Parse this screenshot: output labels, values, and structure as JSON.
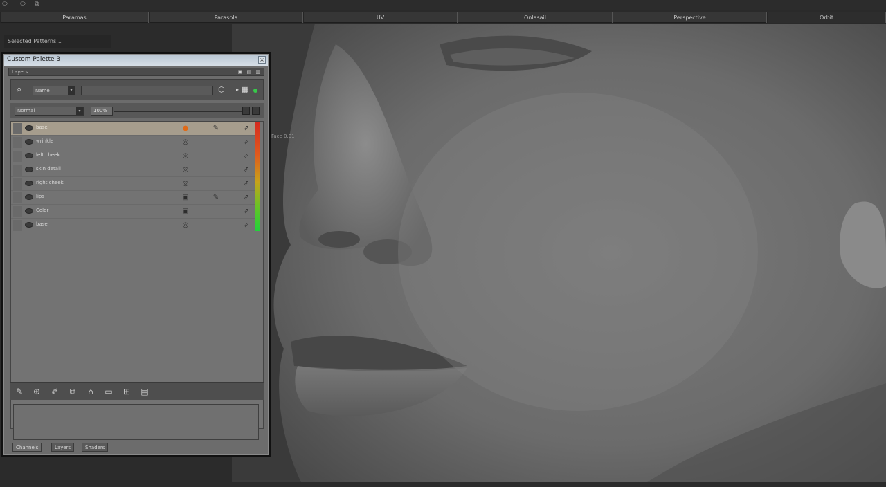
{
  "topbar": {
    "icons": [
      "tool-icon-1",
      "tool-icon-2",
      "tool-icon-3"
    ]
  },
  "tabs": [
    {
      "label": "Paramas"
    },
    {
      "label": "Parasola"
    },
    {
      "label": "UV"
    },
    {
      "label": "Onlasail"
    },
    {
      "label": "Perspective"
    },
    {
      "label": "Orbit"
    }
  ],
  "viewport": {
    "selection_label": "Selected Patterns  1",
    "side_label": "Face 0.01"
  },
  "panel": {
    "title": "Custom Palette 3",
    "subhead_label": "Layers",
    "subhead_buttons": "▣ ▤ ▥",
    "filter_value": "Name",
    "search_value": "",
    "blend_mode": "Normal",
    "opacity": "100%",
    "layers": [
      {
        "name": "base",
        "selected": true,
        "c1": "●",
        "c1_orange": true,
        "c2": "✎",
        "c3": "⇗"
      },
      {
        "name": "wrinkle",
        "selected": false,
        "c1": "◎",
        "c1_orange": false,
        "c2": "",
        "c3": "⇗"
      },
      {
        "name": "left cheek",
        "selected": false,
        "c1": "◎",
        "c1_orange": false,
        "c2": "",
        "c3": "⇗"
      },
      {
        "name": "skin detail",
        "selected": false,
        "c1": "◎",
        "c1_orange": false,
        "c2": "",
        "c3": "⇗"
      },
      {
        "name": "right cheek",
        "selected": false,
        "c1": "◎",
        "c1_orange": false,
        "c2": "",
        "c3": "⇗"
      },
      {
        "name": "lips",
        "selected": false,
        "c1": "▣",
        "c1_orange": false,
        "c2": "✎",
        "c3": "⇗"
      },
      {
        "name": "Color",
        "selected": false,
        "c1": "▣",
        "c1_orange": false,
        "c2": "",
        "c3": "⇗"
      },
      {
        "name": "base",
        "selected": false,
        "c1": "◎",
        "c1_orange": false,
        "c2": "",
        "c3": "⇗"
      }
    ],
    "bottom_tabs": [
      {
        "label": "Channels"
      },
      {
        "label": "Layers"
      },
      {
        "label": "Shaders"
      }
    ]
  },
  "colors": {
    "selected_row": "#a69d8d",
    "accent_orange": "#e06a17",
    "status_green": "#37c94a"
  }
}
